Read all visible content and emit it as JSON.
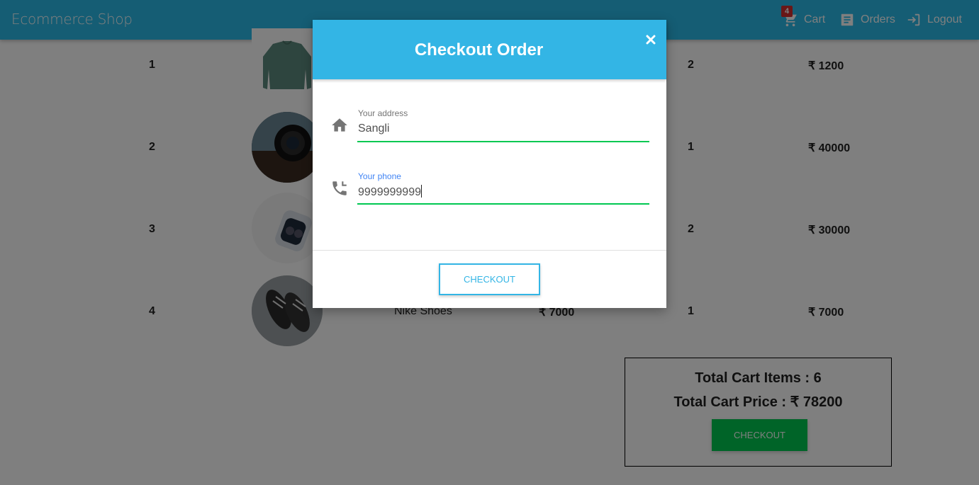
{
  "navbar": {
    "brand": "Ecommerce Shop",
    "cart_label": "Cart",
    "cart_count": "4",
    "orders_label": "Orders",
    "logout_label": "Logout",
    "color": "#2bbbe8"
  },
  "cart": {
    "rows": [
      {
        "index": "1",
        "name": "",
        "image": "sweater-thumbnail",
        "price": "",
        "quantity": "2",
        "total": "₹ 1200"
      },
      {
        "index": "2",
        "name": "",
        "image": "camera-lens-thumbnail",
        "price": "",
        "quantity": "1",
        "total": "₹ 40000"
      },
      {
        "index": "3",
        "name": "",
        "image": "earbuds-thumbnail",
        "price": "",
        "quantity": "2",
        "total": "₹ 30000"
      },
      {
        "index": "4",
        "name": "Nike Shoes",
        "image": "shoes-thumbnail",
        "price": "₹ 7000",
        "quantity": "1",
        "total": "₹ 7000"
      }
    ],
    "summary": {
      "total_items": "Total Cart Items : 6",
      "total_price": "Total Cart Price : ₹ 78200",
      "checkout_label": "CHECKOUT",
      "checkout_color": "#00c851"
    }
  },
  "modal": {
    "title": "Checkout Order",
    "close_icon": "times-icon",
    "address": {
      "label": "Your address",
      "value": "Sangli",
      "icon": "home-icon"
    },
    "phone": {
      "label": "Your phone",
      "value": "9999999999",
      "icon": "phone-forward-icon"
    },
    "checkout_label": "CHECKOUT",
    "header_color": "#33b5e5"
  }
}
